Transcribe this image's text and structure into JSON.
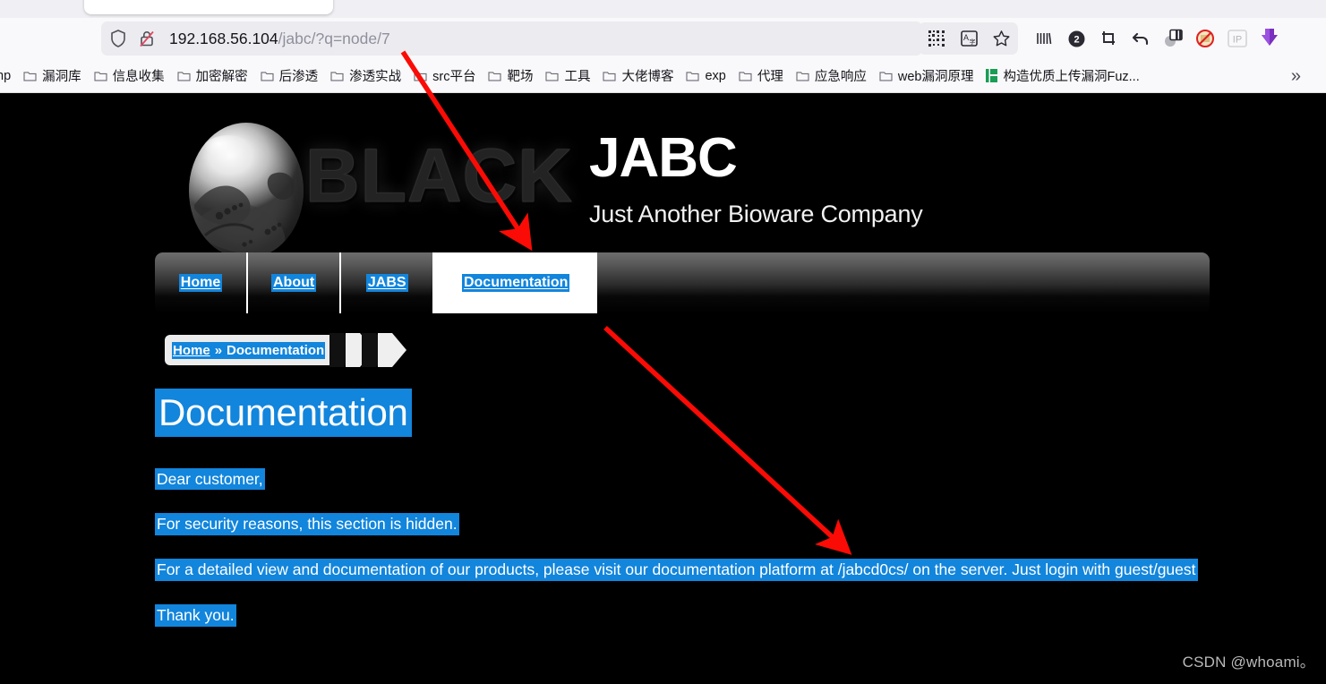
{
  "browser": {
    "url_host": "192.168.56.104",
    "url_path": "/jabc/?q=node/7",
    "shield_icon": "shield-icon",
    "insecure_lock_icon": "lock-crossed-icon",
    "toolbar_icons": [
      {
        "name": "qr-code-icon",
        "label": "QR"
      },
      {
        "name": "translate-icon",
        "label": "A"
      },
      {
        "name": "bookmark-star-icon",
        "label": "star"
      },
      {
        "name": "library-icon",
        "label": "||||"
      },
      {
        "name": "container-badge-icon",
        "label": "2"
      },
      {
        "name": "screenshot-crop-icon",
        "label": "crop"
      },
      {
        "name": "undo-arrow-icon",
        "label": "undo"
      },
      {
        "name": "reader-split-icon",
        "label": "split"
      },
      {
        "name": "block-script-icon",
        "label": "block"
      },
      {
        "name": "ip-extension-icon",
        "label": "IP"
      },
      {
        "name": "purple-extension-icon",
        "label": "ext"
      }
    ],
    "bookmarks": [
      {
        "label": "hp",
        "icon": "none"
      },
      {
        "label": "漏洞库",
        "icon": "folder-icon"
      },
      {
        "label": "信息收集",
        "icon": "folder-icon"
      },
      {
        "label": "加密解密",
        "icon": "folder-icon"
      },
      {
        "label": "后渗透",
        "icon": "folder-icon"
      },
      {
        "label": "渗透实战",
        "icon": "folder-icon"
      },
      {
        "label": "src平台",
        "icon": "folder-icon"
      },
      {
        "label": "靶场",
        "icon": "folder-icon"
      },
      {
        "label": "工具",
        "icon": "folder-icon"
      },
      {
        "label": "大佬博客",
        "icon": "folder-icon"
      },
      {
        "label": "exp",
        "icon": "folder-icon"
      },
      {
        "label": "代理",
        "icon": "folder-icon"
      },
      {
        "label": "应急响应",
        "icon": "folder-icon"
      },
      {
        "label": "web漏洞原理",
        "icon": "folder-icon"
      },
      {
        "label": "构造优质上传漏洞Fuz...",
        "icon": "green-page-icon"
      }
    ],
    "overflow_label": "»"
  },
  "site": {
    "logo_word": "BLACK",
    "title": "JABC",
    "subtitle": "Just Another Bioware Company",
    "nav": [
      {
        "label": "Home",
        "active": false
      },
      {
        "label": "About",
        "active": false
      },
      {
        "label": "JABS",
        "active": false
      },
      {
        "label": "Documentation",
        "active": true
      }
    ],
    "breadcrumb": {
      "home": "Home",
      "separator": "»",
      "current": "Documentation"
    },
    "heading": "Documentation",
    "paragraphs": [
      "Dear customer,",
      "For security reasons, this section is hidden.",
      "For a detailed view and documentation of our products, please visit our documentation platform at /jabcd0cs/ on the server. Just login with guest/guest",
      "Thank you."
    ]
  },
  "watermark": "CSDN @whoami。",
  "colors": {
    "selection_blue": "#1285dc",
    "page_background": "#000000",
    "chrome_background": "#f9f9fb",
    "annotation_red": "#fb0b05"
  }
}
